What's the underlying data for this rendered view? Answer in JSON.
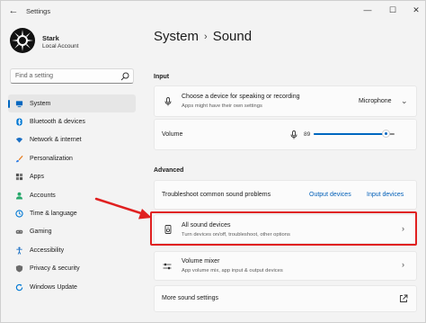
{
  "window": {
    "title": "Settings",
    "back_glyph": "←",
    "minimize_glyph": "—",
    "maximize_glyph": "☐",
    "close_glyph": "✕"
  },
  "account": {
    "name": "Stark",
    "type": "Local Account"
  },
  "search": {
    "placeholder": "Find a setting",
    "icon": "search-icon"
  },
  "sidebar": {
    "items": [
      {
        "label": "System",
        "icon": "system-icon",
        "color": "#0067c0",
        "active": true
      },
      {
        "label": "Bluetooth & devices",
        "icon": "bluetooth-icon",
        "color": "#0078d4"
      },
      {
        "label": "Network & internet",
        "icon": "wifi-icon",
        "color": "#1a6fc4"
      },
      {
        "label": "Personalization",
        "icon": "brush-icon",
        "color": "#e67e22"
      },
      {
        "label": "Apps",
        "icon": "apps-icon",
        "color": "#555555"
      },
      {
        "label": "Accounts",
        "icon": "person-icon",
        "color": "#27a86b"
      },
      {
        "label": "Time & language",
        "icon": "clock-globe-icon",
        "color": "#0078d4"
      },
      {
        "label": "Gaming",
        "icon": "gamepad-icon",
        "color": "#6b6b6b"
      },
      {
        "label": "Accessibility",
        "icon": "accessibility-icon",
        "color": "#1a6fc4"
      },
      {
        "label": "Privacy & security",
        "icon": "shield-icon",
        "color": "#6b6b6b"
      },
      {
        "label": "Windows Update",
        "icon": "update-icon",
        "color": "#0078d4"
      }
    ]
  },
  "breadcrumb": {
    "parent": "System",
    "separator": "›",
    "current": "Sound"
  },
  "input": {
    "section_label": "Input",
    "device_row": {
      "title": "Choose a device for speaking or recording",
      "subtitle": "Apps might have their own settings",
      "value": "Microphone"
    },
    "volume_row": {
      "label": "Volume",
      "value": "89",
      "level_percent": 89
    }
  },
  "advanced": {
    "section_label": "Advanced",
    "troubleshoot": {
      "title": "Troubleshoot common sound problems",
      "output_link": "Output devices",
      "input_link": "Input devices"
    },
    "all_sound_devices": {
      "title": "All sound devices",
      "subtitle": "Turn devices on/off, troubleshoot, other options"
    },
    "volume_mixer": {
      "title": "Volume mixer",
      "subtitle": "App volume mix, app input & output devices"
    },
    "more_sound_settings": {
      "title": "More sound settings"
    }
  },
  "annotation": {
    "highlight_color": "#e02020"
  }
}
